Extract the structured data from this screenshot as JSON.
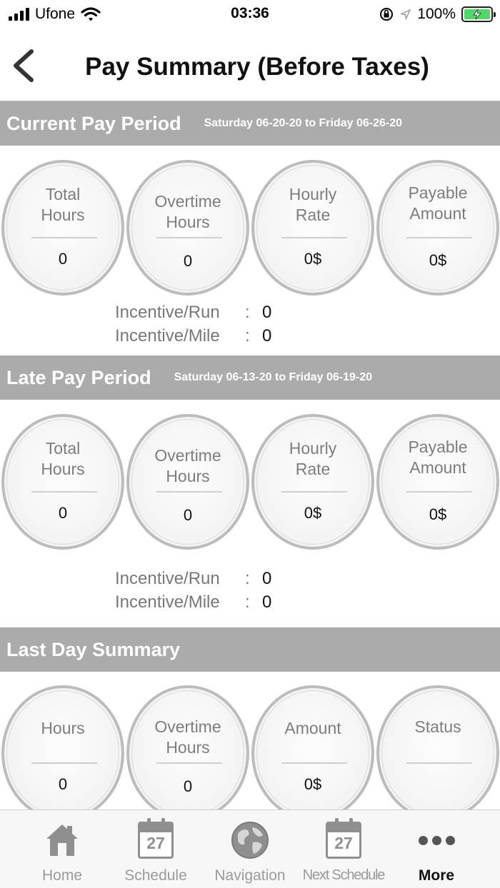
{
  "status_bar": {
    "carrier": "Ufone",
    "time": "03:36",
    "battery": "100%"
  },
  "header": {
    "title": "Pay Summary (Before Taxes)"
  },
  "current_period": {
    "title": "Current Pay Period",
    "range": "Saturday 06-20-20 to Friday 06-26-20",
    "stats": [
      {
        "label": "Total Hours",
        "value": "0"
      },
      {
        "label": "Overtime Hours",
        "value": "0"
      },
      {
        "label": "Hourly Rate",
        "value": "0$"
      },
      {
        "label": "Payable Amount",
        "value": "0$"
      }
    ],
    "incentives": [
      {
        "label": "Incentive/Run",
        "value": "0"
      },
      {
        "label": "Incentive/Mile",
        "value": "0"
      }
    ]
  },
  "late_period": {
    "title": "Late Pay Period",
    "range": "Saturday 06-13-20 to Friday 06-19-20",
    "stats": [
      {
        "label": "Total Hours",
        "value": "0"
      },
      {
        "label": "Overtime Hours",
        "value": "0"
      },
      {
        "label": "Hourly Rate",
        "value": "0$"
      },
      {
        "label": "Payable Amount",
        "value": "0$"
      }
    ],
    "incentives": [
      {
        "label": "Incentive/Run",
        "value": "0"
      },
      {
        "label": "Incentive/Mile",
        "value": "0"
      }
    ]
  },
  "last_day": {
    "title": "Last Day Summary",
    "stats": [
      {
        "label": "Hours",
        "value": "0"
      },
      {
        "label": "Overtime Hours",
        "value": "0"
      },
      {
        "label": "Amount",
        "value": "0$"
      },
      {
        "label": "Status",
        "value": ""
      }
    ]
  },
  "tab_bar": {
    "items": [
      {
        "label": "Home",
        "icon": "home-icon"
      },
      {
        "label": "Schedule",
        "icon": "calendar-icon",
        "day": "27"
      },
      {
        "label": "Navigation",
        "icon": "globe-icon"
      },
      {
        "label": "Next Schedule",
        "icon": "calendar-icon",
        "day": "27"
      },
      {
        "label": "More",
        "icon": "more-icon"
      }
    ],
    "active": "More"
  },
  "colors": {
    "section_bar": "#ababab",
    "battery": "#4cd964",
    "circle_border": "#bcbcbc"
  }
}
